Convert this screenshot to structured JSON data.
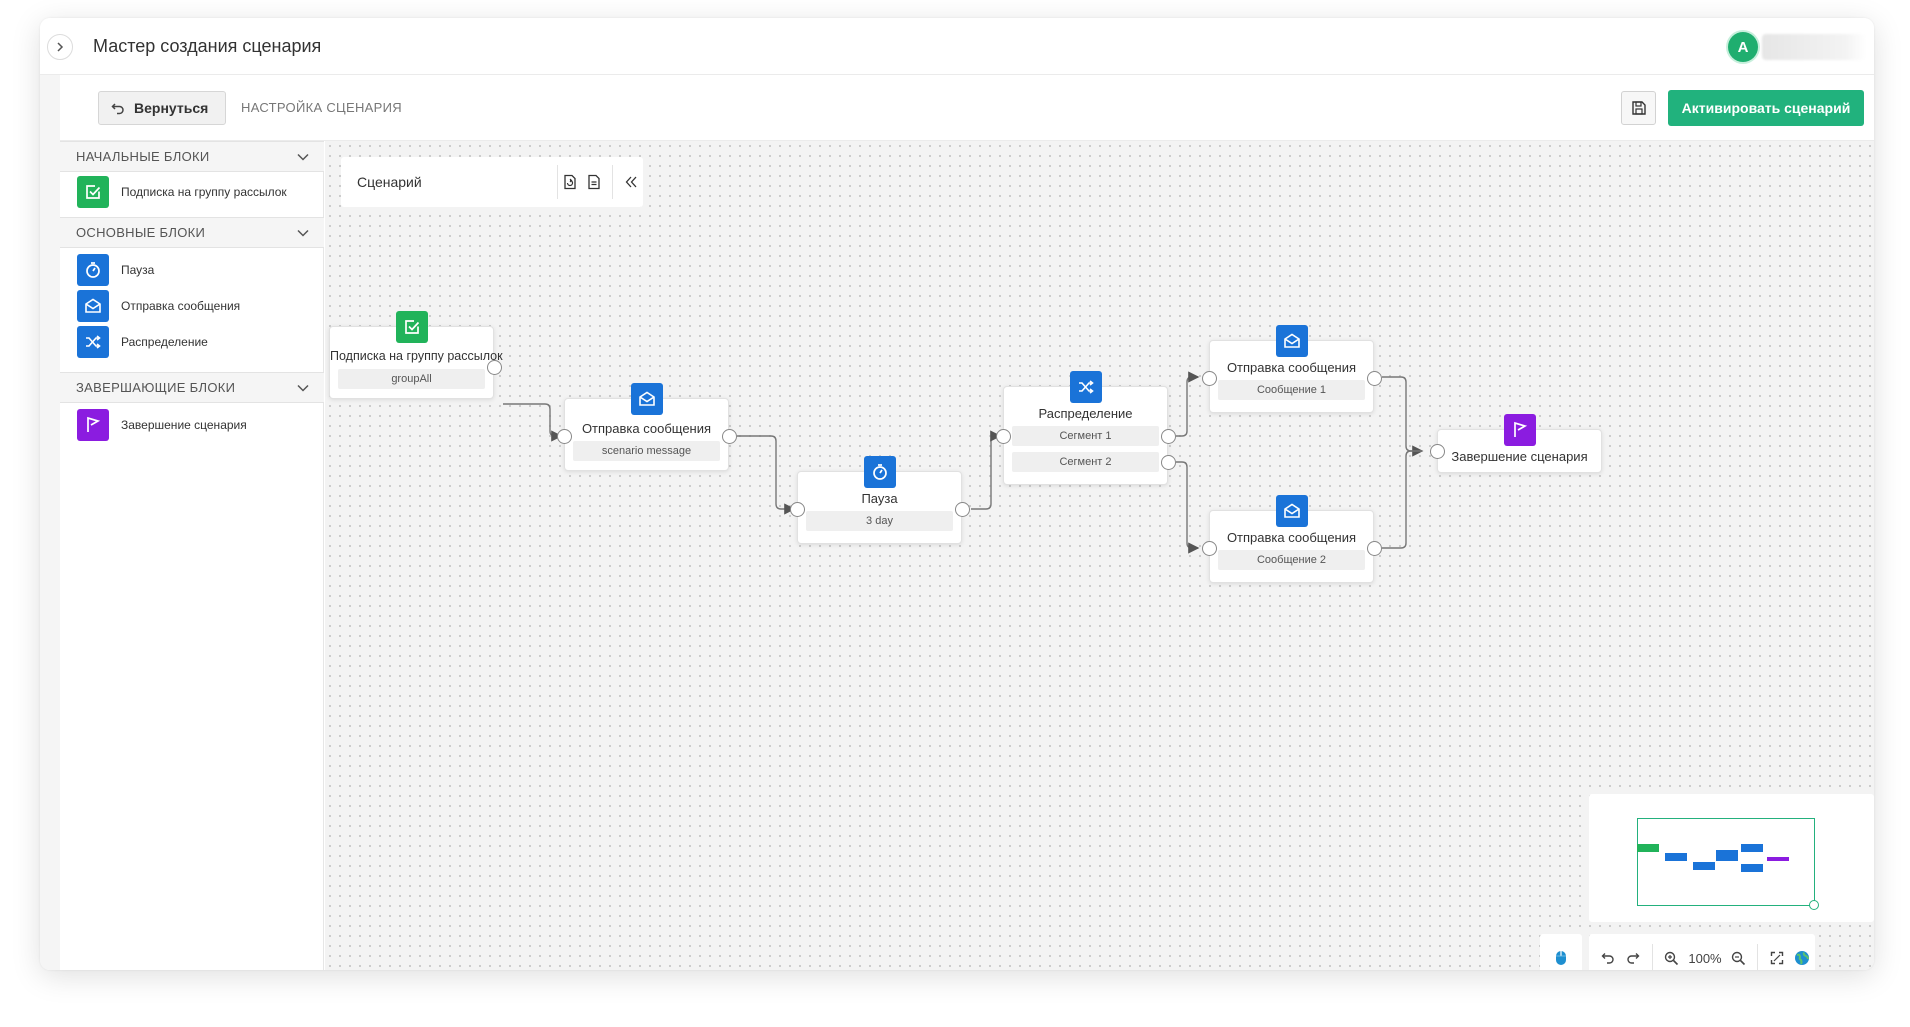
{
  "window": {
    "title": "Мастер создания сценария",
    "avatar_letter": "A"
  },
  "toolbar": {
    "back_label": "Вернуться",
    "section_caption": "НАСТРОЙКА СЦЕНАРИЯ",
    "activate_label": "Активировать сценарий"
  },
  "sidebar": {
    "groups": [
      {
        "title": "НАЧАЛЬНЫЕ БЛОКИ",
        "items": [
          {
            "label": "Подписка на группу рассылок",
            "icon": "checkbox-icon",
            "color": "#21b35a"
          }
        ]
      },
      {
        "title": "ОСНОВНЫЕ БЛОКИ",
        "items": [
          {
            "label": "Пауза",
            "icon": "timer-icon",
            "color": "#1a73d8"
          },
          {
            "label": "Отправка сообщения",
            "icon": "envelope-icon",
            "color": "#1a73d8"
          },
          {
            "label": "Распределение",
            "icon": "shuffle-icon",
            "color": "#1a73d8"
          }
        ]
      },
      {
        "title": "ЗАВЕРШАЮЩИЕ БЛОКИ",
        "items": [
          {
            "label": "Завершение сценария",
            "icon": "flag-icon",
            "color": "#8b1ce0"
          }
        ]
      }
    ]
  },
  "canvas": {
    "scenario_label": "Сценарий",
    "zoom": "100%",
    "nodes": [
      {
        "title": "Подписка на группу рассылок",
        "tags": [
          "groupAll"
        ],
        "icon": "checkbox-icon",
        "color": "#21b35a"
      },
      {
        "title": "Отправка сообщения",
        "tags": [
          "scenario message"
        ],
        "icon": "envelope-icon",
        "color": "#1a73d8"
      },
      {
        "title": "Пауза",
        "tags": [
          "3 day"
        ],
        "icon": "timer-icon",
        "color": "#1a73d8"
      },
      {
        "title": "Распределение",
        "tags": [
          "Сегмент 1",
          "Сегмент 2"
        ],
        "icon": "shuffle-icon",
        "color": "#1a73d8"
      },
      {
        "title": "Отправка сообщения",
        "tags": [
          "Сообщение 1"
        ],
        "icon": "envelope-icon",
        "color": "#1a73d8"
      },
      {
        "title": "Отправка сообщения",
        "tags": [
          "Сообщение 2"
        ],
        "icon": "envelope-icon",
        "color": "#1a73d8"
      },
      {
        "title": "Завершение сценария",
        "tags": [],
        "icon": "flag-icon",
        "color": "#8b1ce0"
      }
    ]
  },
  "colors": {
    "accent": "#21b27d",
    "blue": "#1a73d8",
    "green": "#21b35a",
    "purple": "#8b1ce0"
  }
}
